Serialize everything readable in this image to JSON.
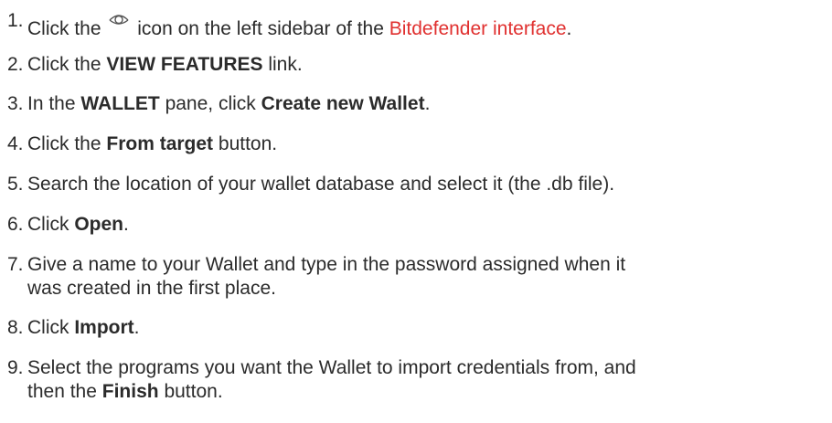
{
  "steps": [
    {
      "number": "1.",
      "text_before": "Click the",
      "icon": "eye-icon",
      "text_middle": "icon on the left sidebar of the",
      "link": "Bitdefender interface",
      "text_after": "."
    },
    {
      "number": "2.",
      "text_before": "Click the",
      "bold": "VIEW FEATURES",
      "text_after": "link."
    },
    {
      "number": "3.",
      "text_before": "In the",
      "bold": "WALLET",
      "text_middle": "pane, click",
      "bold2": "Create new Wallet",
      "text_after": "."
    },
    {
      "number": "4.",
      "text_before": "Click the",
      "bold": "From target",
      "text_after": "button."
    },
    {
      "number": "5.",
      "text": "Search the location of your wallet database and select it (the .db file)."
    },
    {
      "number": "6.",
      "text_before": "Click",
      "bold": "Open",
      "text_after": "."
    },
    {
      "number": "7.",
      "line1": "Give a name to your Wallet and type in the password assigned when it",
      "line2": "was created in the first place."
    },
    {
      "number": "8.",
      "text_before": "Click",
      "bold": "Import",
      "text_after": "."
    },
    {
      "number": "9.",
      "line1": "Select the programs you want the Wallet to import credentials from, and",
      "line2_before": "then the",
      "line2_bold": "Finish",
      "line2_after": "button."
    }
  ],
  "colors": {
    "text": "#2b2b2b",
    "link": "#e0302f"
  }
}
